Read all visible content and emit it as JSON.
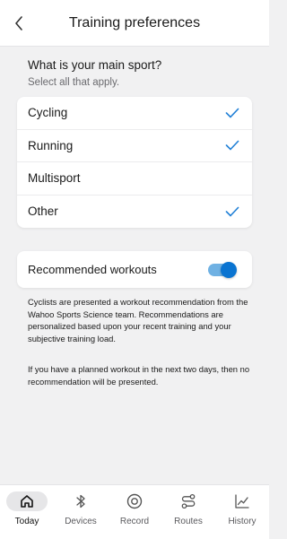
{
  "header": {
    "title": "Training preferences",
    "back_icon": "chevron-left-icon"
  },
  "sport_section": {
    "question": "What is your main sport?",
    "hint": "Select all that apply.",
    "options": [
      {
        "label": "Cycling",
        "checked": true
      },
      {
        "label": "Running",
        "checked": true
      },
      {
        "label": "Multisport",
        "checked": false
      },
      {
        "label": "Other",
        "checked": true
      }
    ]
  },
  "recommended": {
    "label": "Recommended workouts",
    "enabled": true
  },
  "description": {
    "paragraph1": "Cyclists are presented a workout recommendation from the Wahoo Sports Science team. Recommendations are personalized based upon your recent training and your subjective training load.",
    "paragraph2": "If you have a planned workout in the next two days, then no recommendation will be presented."
  },
  "tabbar": {
    "tabs": [
      {
        "label": "Today",
        "icon": "home-icon",
        "active": true
      },
      {
        "label": "Devices",
        "icon": "bluetooth-icon",
        "active": false
      },
      {
        "label": "Record",
        "icon": "record-icon",
        "active": false
      },
      {
        "label": "Routes",
        "icon": "route-icon",
        "active": false
      },
      {
        "label": "History",
        "icon": "chart-icon",
        "active": false
      }
    ]
  },
  "colors": {
    "accent": "#0a74d1",
    "check": "#1f7fd6",
    "toggle_track": "#6fb1e3",
    "background": "#f1f1f2"
  }
}
